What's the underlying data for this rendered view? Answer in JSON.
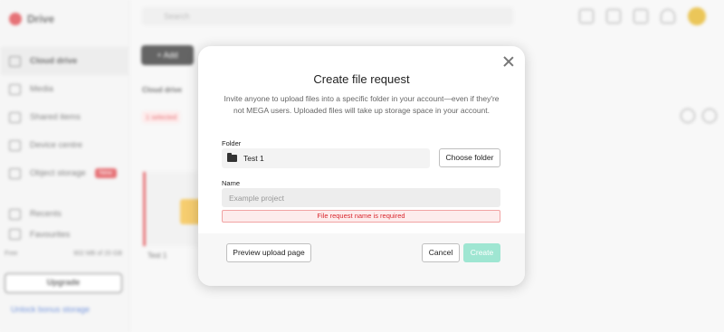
{
  "app": {
    "brand": "Drive",
    "search_placeholder": "Search",
    "nav": [
      {
        "label": "Cloud drive",
        "icon": "cloud-icon"
      },
      {
        "label": "Media",
        "icon": "media-icon"
      },
      {
        "label": "Shared items",
        "icon": "shared-icon"
      },
      {
        "label": "Device centre",
        "icon": "device-icon"
      },
      {
        "label": "Object storage",
        "icon": "storage-icon",
        "badge": "New"
      },
      {
        "label": "Recents",
        "icon": "clock-icon"
      },
      {
        "label": "Favourites",
        "icon": "star-icon"
      }
    ],
    "storage_label": "Free",
    "storage_value": "902 MB of 20 GB",
    "upgrade_label": "Upgrade",
    "bonus_label": "Unlock bonus storage",
    "add_label": "+ Add",
    "breadcrumb": "Cloud drive",
    "selected_label": "1 selected",
    "tile_name": "Test 1",
    "accent_color": "#d9272e"
  },
  "dialog": {
    "title": "Create file request",
    "description": "Invite anyone to upload files into a specific folder in your account—even if they're not MEGA users. Uploaded files will take up storage space in your account.",
    "folder_label": "Folder",
    "folder_value": "Test 1",
    "choose_folder_label": "Choose folder",
    "name_label": "Name",
    "name_placeholder": "Example project",
    "name_value": "",
    "error_text": "File request name is required",
    "preview_label": "Preview upload page",
    "cancel_label": "Cancel",
    "create_label": "Create",
    "create_color": "#9fe6d2"
  }
}
